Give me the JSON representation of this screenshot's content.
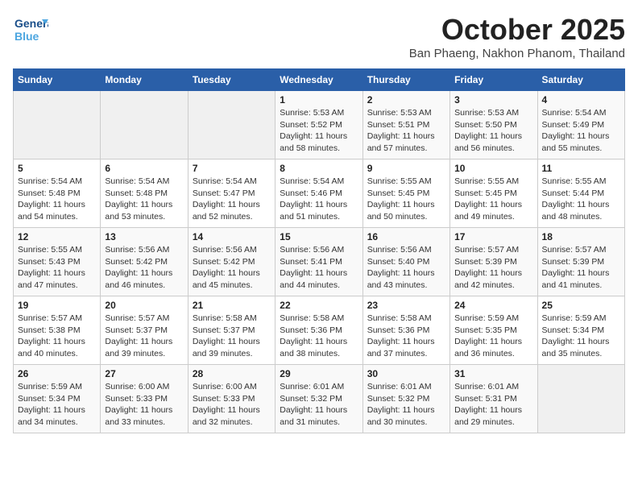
{
  "header": {
    "logo_line1": "General",
    "logo_line2": "Blue",
    "month_title": "October 2025",
    "subtitle": "Ban Phaeng, Nakhon Phanom, Thailand"
  },
  "weekdays": [
    "Sunday",
    "Monday",
    "Tuesday",
    "Wednesday",
    "Thursday",
    "Friday",
    "Saturday"
  ],
  "weeks": [
    [
      {
        "num": "",
        "info": ""
      },
      {
        "num": "",
        "info": ""
      },
      {
        "num": "",
        "info": ""
      },
      {
        "num": "1",
        "info": "Sunrise: 5:53 AM\nSunset: 5:52 PM\nDaylight: 11 hours and 58 minutes."
      },
      {
        "num": "2",
        "info": "Sunrise: 5:53 AM\nSunset: 5:51 PM\nDaylight: 11 hours and 57 minutes."
      },
      {
        "num": "3",
        "info": "Sunrise: 5:53 AM\nSunset: 5:50 PM\nDaylight: 11 hours and 56 minutes."
      },
      {
        "num": "4",
        "info": "Sunrise: 5:54 AM\nSunset: 5:49 PM\nDaylight: 11 hours and 55 minutes."
      }
    ],
    [
      {
        "num": "5",
        "info": "Sunrise: 5:54 AM\nSunset: 5:48 PM\nDaylight: 11 hours and 54 minutes."
      },
      {
        "num": "6",
        "info": "Sunrise: 5:54 AM\nSunset: 5:48 PM\nDaylight: 11 hours and 53 minutes."
      },
      {
        "num": "7",
        "info": "Sunrise: 5:54 AM\nSunset: 5:47 PM\nDaylight: 11 hours and 52 minutes."
      },
      {
        "num": "8",
        "info": "Sunrise: 5:54 AM\nSunset: 5:46 PM\nDaylight: 11 hours and 51 minutes."
      },
      {
        "num": "9",
        "info": "Sunrise: 5:55 AM\nSunset: 5:45 PM\nDaylight: 11 hours and 50 minutes."
      },
      {
        "num": "10",
        "info": "Sunrise: 5:55 AM\nSunset: 5:45 PM\nDaylight: 11 hours and 49 minutes."
      },
      {
        "num": "11",
        "info": "Sunrise: 5:55 AM\nSunset: 5:44 PM\nDaylight: 11 hours and 48 minutes."
      }
    ],
    [
      {
        "num": "12",
        "info": "Sunrise: 5:55 AM\nSunset: 5:43 PM\nDaylight: 11 hours and 47 minutes."
      },
      {
        "num": "13",
        "info": "Sunrise: 5:56 AM\nSunset: 5:42 PM\nDaylight: 11 hours and 46 minutes."
      },
      {
        "num": "14",
        "info": "Sunrise: 5:56 AM\nSunset: 5:42 PM\nDaylight: 11 hours and 45 minutes."
      },
      {
        "num": "15",
        "info": "Sunrise: 5:56 AM\nSunset: 5:41 PM\nDaylight: 11 hours and 44 minutes."
      },
      {
        "num": "16",
        "info": "Sunrise: 5:56 AM\nSunset: 5:40 PM\nDaylight: 11 hours and 43 minutes."
      },
      {
        "num": "17",
        "info": "Sunrise: 5:57 AM\nSunset: 5:39 PM\nDaylight: 11 hours and 42 minutes."
      },
      {
        "num": "18",
        "info": "Sunrise: 5:57 AM\nSunset: 5:39 PM\nDaylight: 11 hours and 41 minutes."
      }
    ],
    [
      {
        "num": "19",
        "info": "Sunrise: 5:57 AM\nSunset: 5:38 PM\nDaylight: 11 hours and 40 minutes."
      },
      {
        "num": "20",
        "info": "Sunrise: 5:57 AM\nSunset: 5:37 PM\nDaylight: 11 hours and 39 minutes."
      },
      {
        "num": "21",
        "info": "Sunrise: 5:58 AM\nSunset: 5:37 PM\nDaylight: 11 hours and 39 minutes."
      },
      {
        "num": "22",
        "info": "Sunrise: 5:58 AM\nSunset: 5:36 PM\nDaylight: 11 hours and 38 minutes."
      },
      {
        "num": "23",
        "info": "Sunrise: 5:58 AM\nSunset: 5:36 PM\nDaylight: 11 hours and 37 minutes."
      },
      {
        "num": "24",
        "info": "Sunrise: 5:59 AM\nSunset: 5:35 PM\nDaylight: 11 hours and 36 minutes."
      },
      {
        "num": "25",
        "info": "Sunrise: 5:59 AM\nSunset: 5:34 PM\nDaylight: 11 hours and 35 minutes."
      }
    ],
    [
      {
        "num": "26",
        "info": "Sunrise: 5:59 AM\nSunset: 5:34 PM\nDaylight: 11 hours and 34 minutes."
      },
      {
        "num": "27",
        "info": "Sunrise: 6:00 AM\nSunset: 5:33 PM\nDaylight: 11 hours and 33 minutes."
      },
      {
        "num": "28",
        "info": "Sunrise: 6:00 AM\nSunset: 5:33 PM\nDaylight: 11 hours and 32 minutes."
      },
      {
        "num": "29",
        "info": "Sunrise: 6:01 AM\nSunset: 5:32 PM\nDaylight: 11 hours and 31 minutes."
      },
      {
        "num": "30",
        "info": "Sunrise: 6:01 AM\nSunset: 5:32 PM\nDaylight: 11 hours and 30 minutes."
      },
      {
        "num": "31",
        "info": "Sunrise: 6:01 AM\nSunset: 5:31 PM\nDaylight: 11 hours and 29 minutes."
      },
      {
        "num": "",
        "info": ""
      }
    ]
  ]
}
